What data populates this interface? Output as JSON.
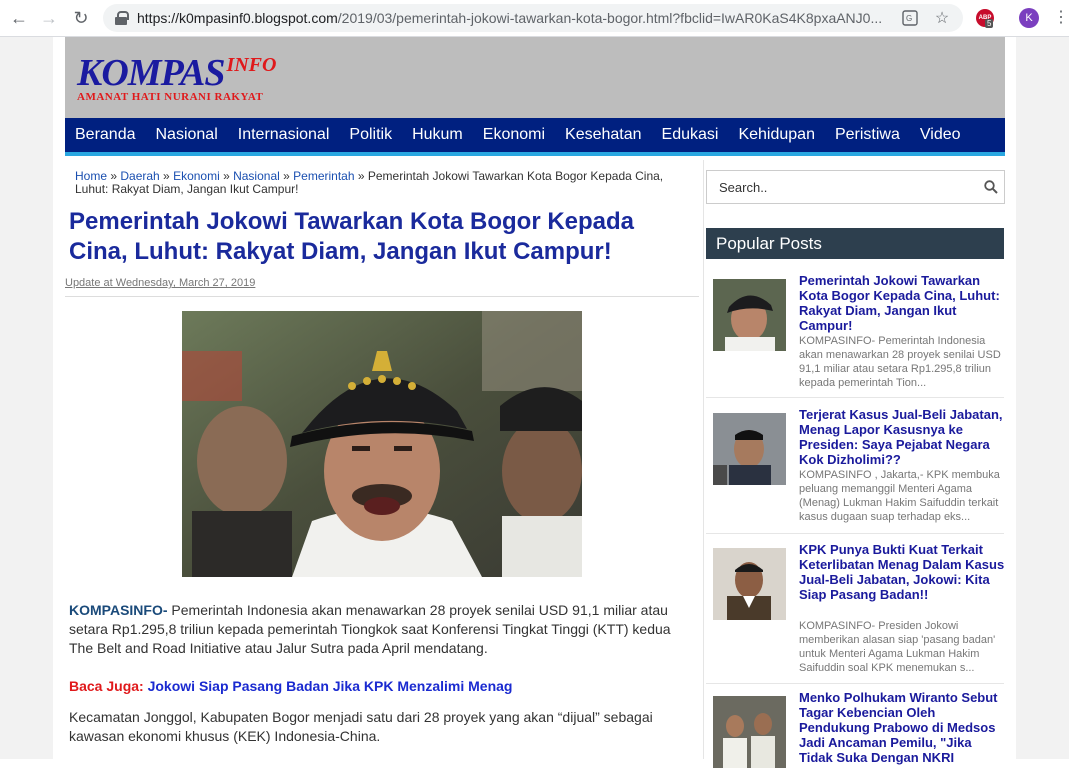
{
  "browser": {
    "url_host": "https://k0mpasinf0.blogspot.com",
    "url_path": "/2019/03/pemerintah-jokowi-tawarkan-kota-bogor.html?fbclid=IwAR0KaS4K8pxaANJ0...",
    "abp_label": "ABP",
    "abp_count": "5",
    "profile_initial": "K"
  },
  "site": {
    "logo_main": "KOMPAS",
    "logo_sup": "INFO",
    "logo_tagline": "AMANAT HATI NURANI RAKYAT",
    "menu": [
      "Beranda",
      "Nasional",
      "Internasional",
      "Politik",
      "Hukum",
      "Ekonomi",
      "Kesehatan",
      "Edukasi",
      "Kehidupan",
      "Peristiwa",
      "Video"
    ]
  },
  "article": {
    "breadcrumb": {
      "home": "Home",
      "sep": " » ",
      "daerah": "Daerah",
      "ekonomi": "Ekonomi",
      "nasional": "Nasional",
      "pemerintah": "Pemerintah",
      "current": "Pemerintah Jokowi Tawarkan Kota Bogor Kepada Cina, Luhut: Rakyat Diam, Jangan Ikut Campur!"
    },
    "title": "Pemerintah Jokowi Tawarkan Kota Bogor Kepada Cina, Luhut: Rakyat Diam, Jangan Ikut Campur!",
    "update": "Update at Wednesday, March 27, 2019",
    "lead_source": "KOMPASINFO-",
    "lead_text": " Pemerintah Indonesia akan menawarkan 28 proyek senilai USD 91,1 miliar atau setara Rp1.295,8 triliun kepada pemerintah Tiongkok saat Konferensi Tingkat Tinggi (KTT) kedua The Belt and Road Initiative atau Jalur Sutra pada April mendatang.",
    "baca_label": "Baca Juga:",
    "baca_link": "Jokowi Siap Pasang Badan Jika KPK Menzalimi Menag",
    "para2": "Kecamatan Jonggol, Kabupaten Bogor menjadi satu dari 28 proyek yang akan “dijual” sebagai kawasan ekonomi khusus (KEK) Indonesia-China."
  },
  "sidebar": {
    "search_placeholder": "Search..",
    "popular_heading": "Popular Posts",
    "posts": [
      {
        "title": "Pemerintah Jokowi Tawarkan Kota Bogor Kepada Cina, Luhut: Rakyat Diam, Jangan Ikut Campur!",
        "excerpt": "KOMPASINFO- Pemerintah Indonesia akan menawarkan 28 proyek senilai USD 91,1 miliar atau setara Rp1.295,8 triliun kepada pemerintah Tion..."
      },
      {
        "title": "Terjerat Kasus Jual-Beli Jabatan, Menag Lapor Kasusnya ke Presiden: Saya Pejabat Negara Kok Dizholimi??",
        "excerpt": "KOMPASINFO , Jakarta,- KPK membuka peluang memanggil Menteri Agama (Menag) Lukman Hakim Saifuddin terkait kasus dugaan suap terhadap eks..."
      },
      {
        "title": "KPK Punya Bukti Kuat Terkait Keterlibatan Menag Dalam Kasus Jual-Beli Jabatan, Jokowi: Kita Siap Pasang Badan!!",
        "excerpt": "KOMPASINFO- Presiden Jokowi memberikan alasan siap 'pasang badan' untuk Menteri Agama Lukman Hakim Saifuddin soal KPK menemukan s..."
      },
      {
        "title": "Menko Polhukam Wiranto Sebut Tagar Kebencian Oleh Pendukung Prabowo di Medsos Jadi Ancaman Pemilu, \"Jika Tidak Suka Dengan NKRI",
        "excerpt": ""
      }
    ]
  }
}
